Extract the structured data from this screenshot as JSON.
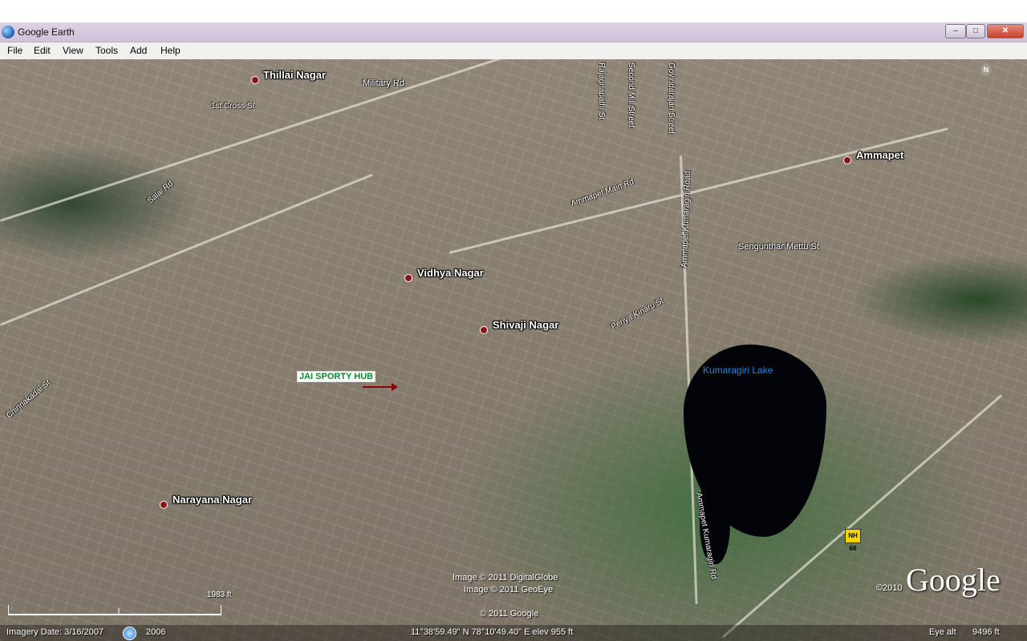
{
  "window": {
    "title": "Google Earth",
    "minimize": "–",
    "maximize": "□",
    "close": "✕"
  },
  "menu": {
    "items": [
      "File",
      "Edit",
      "View",
      "Tools",
      "Add",
      "Help"
    ]
  },
  "map": {
    "places": [
      {
        "name": "Thillai Nagar"
      },
      {
        "name": "Ammapet"
      },
      {
        "name": "Vidhya Nagar"
      },
      {
        "name": "Shivaji Nagar"
      },
      {
        "name": "Narayana Nagar"
      }
    ],
    "streets": [
      "Military Rd",
      "1st Cross St",
      "Salai Rd",
      "Ammapet Main Rd",
      "Second Mill Street",
      "Rajagnapathi St",
      "Govindarajan Street",
      "Ammapet Kumaragiri Road",
      "Sengunthar Mettu St",
      "Periya Kinaru St",
      "Chinnakadai St",
      "Ammapet Kumaragiri Rd"
    ],
    "placemark": "JAI SPORTY HUB",
    "lake_label": "Kumaragiri Lake",
    "highway_shield": "NH 68",
    "compass": "N"
  },
  "attribution": {
    "line1": "Image © 2011 DigitalGlobe",
    "line2": "Image © 2011 GeoEye",
    "line3": "© 2011 Google",
    "year": "©2010",
    "logo": "Google"
  },
  "scale": {
    "label": "1983 ft"
  },
  "status": {
    "imagery_date": "Imagery Date: 3/16/2007",
    "history_year": "2006",
    "coordinates": "11°38'59.49\" N  78°10'49.40\" E  elev  955 ft",
    "eye_alt_label": "Eye alt",
    "eye_alt_value": "9496 ft"
  },
  "colors": {
    "placemark_text": "#0a8a2a",
    "lake_label": "#1e88e5",
    "place_dot": "#8b1414",
    "lake": "#020409"
  }
}
